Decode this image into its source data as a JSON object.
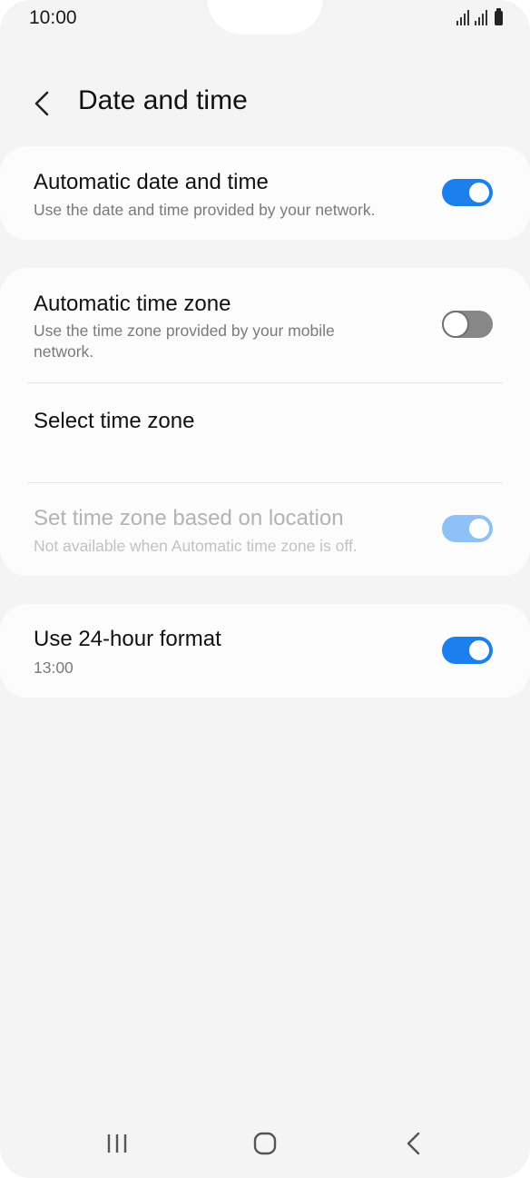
{
  "status_bar": {
    "time": "10:00"
  },
  "header": {
    "title": "Date and time",
    "back_icon": "chevron-left-icon"
  },
  "settings": {
    "auto_date_time": {
      "title": "Automatic date and time",
      "subtitle": "Use the date and time provided by your network.",
      "enabled": true
    },
    "auto_time_zone": {
      "title": "Automatic time zone",
      "subtitle": "Use the time zone provided by your mobile network.",
      "enabled": false
    },
    "select_time_zone": {
      "title": "Select time zone"
    },
    "location_time_zone": {
      "title": "Set time zone based on location",
      "subtitle": "Not available when Automatic time zone is off.",
      "enabled": true,
      "disabled": true
    },
    "hour_format": {
      "title": "Use 24-hour format",
      "subtitle": "13:00",
      "enabled": true
    }
  },
  "colors": {
    "accent": "#1b80ee",
    "toggle_off": "#878787",
    "background": "#f4f4f4"
  },
  "navbar": {
    "icons": [
      "recent-apps-icon",
      "home-icon",
      "back-icon"
    ]
  }
}
